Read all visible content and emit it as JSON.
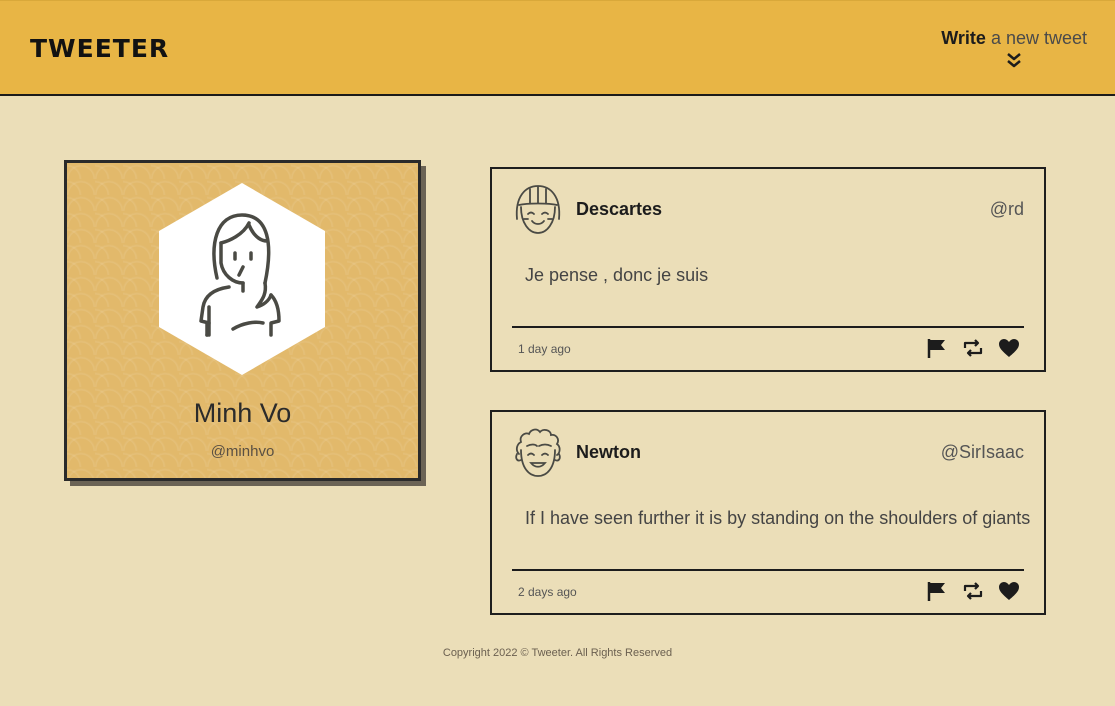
{
  "header": {
    "logo": "TWEETER",
    "compose_strong": "Write",
    "compose_light": "a new tweet",
    "compose_icon": "double-chevron-down-icon"
  },
  "profile": {
    "name": "Minh Vo",
    "handle": "@minhvo",
    "avatar_icon": "woman-avatar-icon"
  },
  "tweets": [
    {
      "author": "Descartes",
      "handle": "@rd",
      "text": "Je pense , donc je suis",
      "time": "1 day ago",
      "avatar_icon": "girl-avatar-icon"
    },
    {
      "author": "Newton",
      "handle": "@SirIsaac",
      "text": "If I have seen further it is by standing on the shoulders of giants",
      "time": "2 days ago",
      "avatar_icon": "curly-hair-avatar-icon"
    }
  ],
  "actions": [
    "flag-icon",
    "retweet-icon",
    "heart-icon"
  ],
  "footer": "Copyright 2022 © Tweeter. All Rights Reserved",
  "colors": {
    "header_bg": "#e8b545",
    "page_bg": "#ebdeb8",
    "card_bg": "#e2b96b",
    "border": "#1e1e1e"
  }
}
